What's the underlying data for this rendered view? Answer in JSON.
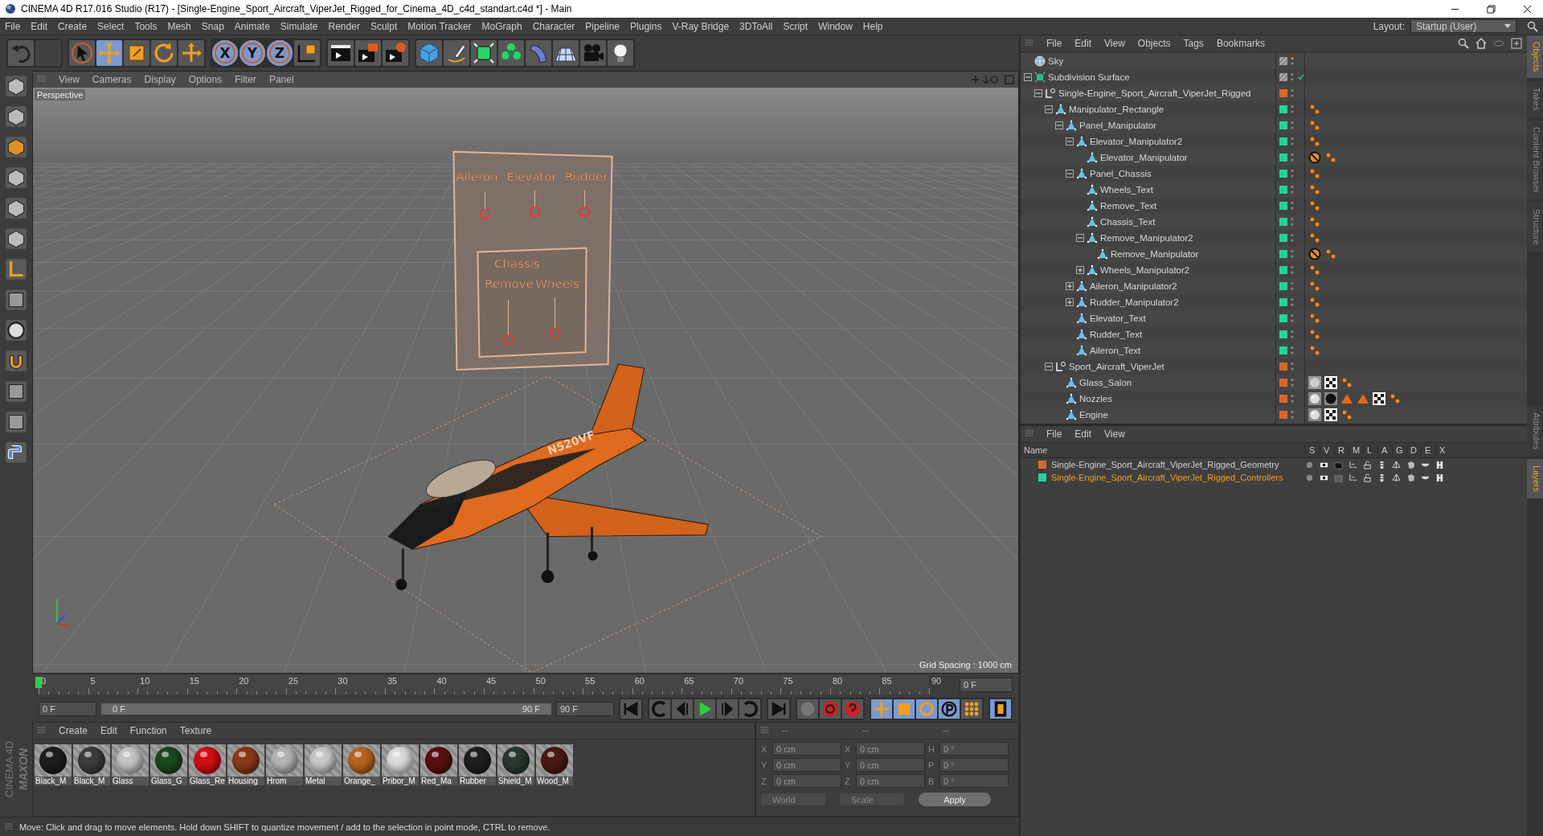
{
  "window": {
    "title": "CINEMA 4D R17.016 Studio (R17) - [Single-Engine_Sport_Aircraft_ViperJet_Rigged_for_Cinema_4D_c4d_standart.c4d *] - Main"
  },
  "menu": [
    "File",
    "Edit",
    "Create",
    "Select",
    "Tools",
    "Mesh",
    "Snap",
    "Animate",
    "Simulate",
    "Render",
    "Sculpt",
    "Motion Tracker",
    "MoGraph",
    "Character",
    "Pipeline",
    "Plugins",
    "V-Ray Bridge",
    "3DToAll",
    "Script",
    "Window",
    "Help"
  ],
  "layout": {
    "label": "Layout:",
    "value": "Startup (User)"
  },
  "toolbar": {
    "tools": [
      {
        "kind": "select",
        "selected": false
      },
      {
        "kind": "move",
        "selected": true
      },
      {
        "kind": "scale",
        "selected": false
      },
      {
        "kind": "rotate",
        "selected": false
      },
      {
        "kind": "transform",
        "selected": false
      }
    ],
    "axes": [
      {
        "label": "X",
        "selected": true
      },
      {
        "label": "Y",
        "selected": true
      },
      {
        "label": "Z",
        "selected": true
      }
    ]
  },
  "viewport": {
    "menu": [
      "View",
      "Cameras",
      "Display",
      "Options",
      "Filter",
      "Panel"
    ],
    "camera": "Perspective",
    "grid_spacing": "Grid Spacing : 1000 cm",
    "panel_labels": [
      "Aileron",
      "Elevator",
      "Rudder"
    ],
    "box_title": "Chassis",
    "box_labels": [
      "Remove",
      "Wheels"
    ],
    "registration": "N520VF"
  },
  "timeline": {
    "ticks": [
      "0",
      "5",
      "10",
      "15",
      "20",
      "25",
      "30",
      "35",
      "40",
      "45",
      "50",
      "55",
      "60",
      "65",
      "70",
      "75",
      "80",
      "85",
      "90"
    ],
    "current_frame": "0 F",
    "start": "0 F",
    "range": {
      "start": "0 F",
      "end": "90 F",
      "level": 1
    },
    "end": "90 F"
  },
  "materials": {
    "menu": [
      "Create",
      "Edit",
      "Function",
      "Texture"
    ],
    "items": [
      {
        "name": "Black_M",
        "color": "#1e1e1e"
      },
      {
        "name": "Black_M",
        "color": "#3c3c3c"
      },
      {
        "name": "Glass",
        "color": "#c4c4c4"
      },
      {
        "name": "Glass_G",
        "color": "#1c4a1c"
      },
      {
        "name": "Glass_Re",
        "color": "#d01010"
      },
      {
        "name": "Housing",
        "color": "#8a3a18"
      },
      {
        "name": "Hrom",
        "color": "#b4b4b4"
      },
      {
        "name": "Metal",
        "color": "#c8c8c8"
      },
      {
        "name": "Orange_",
        "color": "#b86420"
      },
      {
        "name": "Pribor_M",
        "color": "#dcdcdc"
      },
      {
        "name": "Red_Ma",
        "color": "#5a1010"
      },
      {
        "name": "Rubber",
        "color": "#202020"
      },
      {
        "name": "Shield_M",
        "color": "#2a3a30"
      },
      {
        "name": "Wood_M",
        "color": "#4a1a14"
      }
    ]
  },
  "coordinates": {
    "headers": [
      "--",
      "--",
      "--"
    ],
    "rows": [
      {
        "pos_axis": "X",
        "pos": "0 cm",
        "size_axis": "X",
        "size": "0 cm",
        "rot_axis": "H",
        "rot": "0 °"
      },
      {
        "pos_axis": "Y",
        "pos": "0 cm",
        "size_axis": "Y",
        "size": "0 cm",
        "rot_axis": "P",
        "rot": "0 °"
      },
      {
        "pos_axis": "Z",
        "pos": "0 cm",
        "size_axis": "Z",
        "size": "0 cm",
        "rot_axis": "B",
        "rot": "0 °"
      }
    ],
    "space": "World",
    "mode": "Scale",
    "apply": "Apply"
  },
  "logo": [
    "MAXON",
    "CINEMA 4D"
  ],
  "status_bar": "Move: Click and drag to move elements. Hold down SHIFT to quantize movement / add to the selection in point mode, CTRL to remove.",
  "objects": {
    "menu": [
      "File",
      "Edit",
      "View",
      "Objects",
      "Tags",
      "Bookmarks"
    ],
    "items": [
      {
        "name": "Sky",
        "kind": "sky"
      },
      {
        "name": "Subdivision Surface",
        "kind": "subdivision",
        "checked": true,
        "expanded": true,
        "children": [
          {
            "name": "Single-Engine_Sport_Aircraft_ViperJet_Rigged",
            "kind": "null",
            "color": "#d8682c",
            "expanded": true,
            "children": [
              {
                "name": "Manipulator_Rectangle",
                "kind": "polygon",
                "color": "#22d49a",
                "expanded": true,
                "tags": [
                  {
                    "kind": "points"
                  }
                ],
                "children": [
                  {
                    "name": "Panel_Manipulator",
                    "kind": "polygon",
                    "color": "#22d49a",
                    "expanded": true,
                    "tags": [
                      {
                        "kind": "points"
                      }
                    ],
                    "children": [
                      {
                        "name": "Elevator_Manipulator2",
                        "kind": "polygon",
                        "color": "#22d49a",
                        "expanded": true,
                        "tags": [
                          {
                            "kind": "points"
                          }
                        ],
                        "children": [
                          {
                            "name": "Elevator_Manipulator",
                            "kind": "polygon",
                            "color": "#22d49a",
                            "tags": [
                              {
                                "kind": "blocked"
                              },
                              {
                                "kind": "points"
                              }
                            ]
                          }
                        ]
                      },
                      {
                        "name": "Panel_Chassis",
                        "kind": "polygon",
                        "color": "#22d49a",
                        "expanded": true,
                        "tags": [
                          {
                            "kind": "points"
                          }
                        ],
                        "children": [
                          {
                            "name": "Wheels_Text",
                            "kind": "polygon",
                            "color": "#22d49a",
                            "tags": [
                              {
                                "kind": "points"
                              }
                            ]
                          },
                          {
                            "name": "Remove_Text",
                            "kind": "polygon",
                            "color": "#22d49a",
                            "tags": [
                              {
                                "kind": "points"
                              }
                            ]
                          },
                          {
                            "name": "Chassis_Text",
                            "kind": "polygon",
                            "color": "#22d49a",
                            "tags": [
                              {
                                "kind": "points"
                              }
                            ]
                          },
                          {
                            "name": "Remove_Manipulator2",
                            "kind": "polygon",
                            "color": "#22d49a",
                            "expanded": true,
                            "tags": [
                              {
                                "kind": "points"
                              }
                            ],
                            "children": [
                              {
                                "name": "Remove_Manipulator",
                                "kind": "polygon",
                                "color": "#22d49a",
                                "tags": [
                                  {
                                    "kind": "blocked"
                                  },
                                  {
                                    "kind": "points"
                                  }
                                ]
                              }
                            ]
                          },
                          {
                            "name": "Wheels_Manipulator2",
                            "kind": "polygon",
                            "color": "#22d49a",
                            "expanded": false,
                            "tags": [
                              {
                                "kind": "points"
                              }
                            ]
                          }
                        ]
                      },
                      {
                        "name": "Aileron_Manipulator2",
                        "kind": "polygon",
                        "color": "#22d49a",
                        "expanded": false,
                        "tags": [
                          {
                            "kind": "points"
                          }
                        ]
                      },
                      {
                        "name": "Rudder_Manipulator2",
                        "kind": "polygon",
                        "color": "#22d49a",
                        "expanded": false,
                        "tags": [
                          {
                            "kind": "points"
                          }
                        ]
                      },
                      {
                        "name": "Elevator_Text",
                        "kind": "polygon",
                        "color": "#22d49a",
                        "tags": [
                          {
                            "kind": "points"
                          }
                        ]
                      },
                      {
                        "name": "Rudder_Text",
                        "kind": "polygon",
                        "color": "#22d49a",
                        "tags": [
                          {
                            "kind": "points"
                          }
                        ]
                      },
                      {
                        "name": "Aileron_Text",
                        "kind": "polygon",
                        "color": "#22d49a",
                        "tags": [
                          {
                            "kind": "points"
                          }
                        ]
                      }
                    ]
                  }
                ]
              },
              {
                "name": "Sport_Aircraft_ViperJet",
                "kind": "null",
                "color": "#d8682c",
                "expanded": true,
                "children": [
                  {
                    "name": "Glass_Salon",
                    "kind": "polygon",
                    "color": "#d8682c",
                    "tags": [
                      {
                        "kind": "glass"
                      },
                      {
                        "kind": "checker"
                      },
                      {
                        "kind": "points"
                      }
                    ]
                  },
                  {
                    "name": "Nozzles",
                    "kind": "polygon",
                    "color": "#d8682c",
                    "tags": [
                      {
                        "kind": "sphere"
                      },
                      {
                        "kind": "dark"
                      },
                      {
                        "kind": "triangle"
                      },
                      {
                        "kind": "triangle"
                      },
                      {
                        "kind": "checker"
                      },
                      {
                        "kind": "points"
                      }
                    ]
                  },
                  {
                    "name": "Engine",
                    "kind": "polygon",
                    "color": "#d8682c",
                    "tags": [
                      {
                        "kind": "sphere"
                      },
                      {
                        "kind": "checker"
                      },
                      {
                        "kind": "points"
                      }
                    ]
                  }
                ]
              }
            ]
          }
        ]
      }
    ]
  },
  "layers": {
    "menu": [
      "File",
      "Edit",
      "View"
    ],
    "name_header": "Name",
    "flags": [
      "S",
      "V",
      "R",
      "M",
      "L",
      "A",
      "G",
      "D",
      "E",
      "X"
    ],
    "rows": [
      {
        "name": "Single-Engine_Sport_Aircraft_ViperJet_Rigged_Geometry",
        "color": "#d8682c",
        "selected": false
      },
      {
        "name": "Single-Engine_Sport_Aircraft_ViperJet_Rigged_Controllers",
        "color": "#22d49a",
        "selected": true
      }
    ]
  },
  "side_tabs": {
    "top": [
      {
        "label": "Objects",
        "selected": true
      },
      {
        "label": "Takes",
        "selected": false
      },
      {
        "label": "Content Browser",
        "selected": false
      },
      {
        "label": "Structure",
        "selected": false
      }
    ],
    "bottom": [
      {
        "label": "Attributes",
        "selected": false
      },
      {
        "label": "Layers",
        "selected": true
      }
    ]
  }
}
